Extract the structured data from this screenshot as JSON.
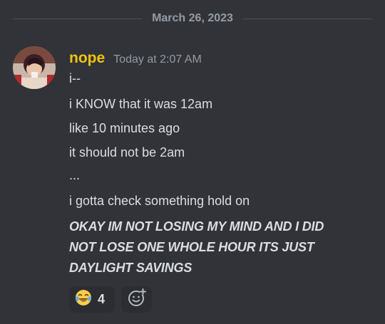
{
  "divider": {
    "date": "March 26, 2023"
  },
  "message": {
    "username": "nope",
    "timestamp": "Today at 2:07 AM",
    "lines": [
      "i--",
      "i KNOW that it was 12am",
      "like 10 minutes ago",
      "it should not be 2am",
      "...",
      "i gotta check something hold on"
    ],
    "italic_lines": [
      "OKAY IM NOT LOSING MY MIND AND I DID",
      "NOT LOSE ONE WHOLE HOUR ITS JUST",
      "DAYLIGHT SAVINGS"
    ]
  },
  "reactions": [
    {
      "emoji": "laughing-crying-icon",
      "count": "4"
    }
  ],
  "colors": {
    "background": "#313338",
    "username": "#f1c40f",
    "text": "#dbdee1",
    "muted": "#949ba4",
    "reaction_bg": "#2b2d31"
  }
}
